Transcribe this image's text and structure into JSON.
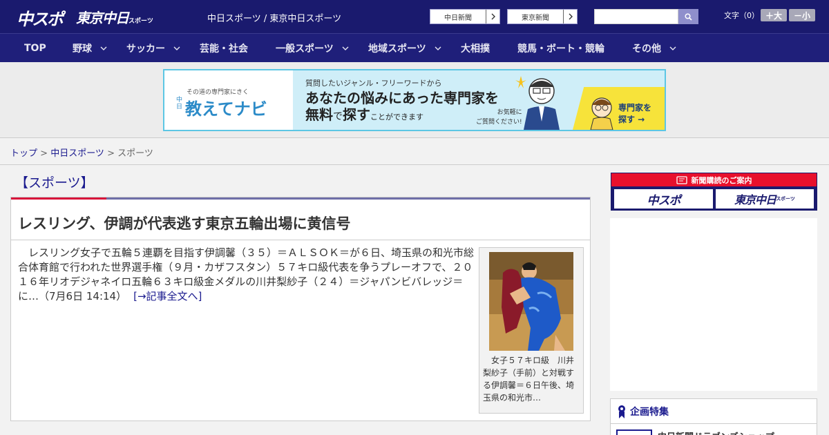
{
  "header": {
    "logo_chuspo": "中スポ",
    "logo_tokyo": "東京中日",
    "logo_tokyo_suffix": "スポーツ",
    "title": "中日スポーツ / 東京中日スポーツ",
    "paper_links": [
      "中日新聞",
      "東京新聞"
    ],
    "search": {
      "value": "",
      "placeholder": ""
    },
    "font_size_label": "文字（0）",
    "font_larger": "＋大",
    "font_smaller": "－小"
  },
  "nav": {
    "items": [
      {
        "label": "TOP",
        "has_menu": false
      },
      {
        "label": "野球",
        "has_menu": true
      },
      {
        "label": "サッカー",
        "has_menu": true
      },
      {
        "label": "芸能・社会",
        "has_menu": false
      },
      {
        "label": "一般スポーツ",
        "has_menu": true
      },
      {
        "label": "地域スポーツ",
        "has_menu": true
      },
      {
        "label": "大相撲",
        "has_menu": false
      },
      {
        "label": "競馬・ボート・競輪",
        "has_menu": false
      },
      {
        "label": "その他",
        "has_menu": true
      }
    ]
  },
  "ad_banner": {
    "tagline": "その道の専門家にきく",
    "brand_prefix": "中日",
    "brand": "教えてナビ",
    "line1": "質問したいジャンル・フリーワードから",
    "line2": "あなたの悩みにあった専門家を",
    "line3_a": "無料",
    "line3_b": "で",
    "line3_c": "探す",
    "line3_d": "ことができます",
    "note_1": "お気軽に",
    "note_2": "ご質問ください!",
    "cta_1": "専門家を",
    "cta_2": "探す →"
  },
  "breadcrumb": {
    "top": "トップ",
    "section": "中日スポーツ",
    "current": "スポーツ",
    "separator": " > "
  },
  "article": {
    "section": "【スポーツ】",
    "headline": "レスリング、伊調が代表逃す東京五輪出場に黄信号",
    "body": "レスリング女子で五輪５連覇を目指す伊調馨（３５）＝ＡＬＳＯＫ＝が６日、埼玉県の和光市総合体育館で行われた世界選手権（９月・カザフスタン）５７キロ級代表を争うプレーオフで、２０１６年リオデジャネイロ五輪６３キロ級金メダルの川井梨紗子（２４）＝ジャパンビバレッジ＝に…",
    "date": "（7月6日 14:14）",
    "more_link": "[→記事全文へ]",
    "photo_caption": "女子５７キロ級　川井梨紗子（手前）と対戦する伊調馨＝６日午後、埼玉県の和光市…"
  },
  "sidebar": {
    "subscribe_header": "新聞購読のご案内",
    "subscribe_chuspo": "中スポ",
    "subscribe_tokyo": "東京中日",
    "subscribe_tokyo_suffix": "スポーツ",
    "feature_header": "企画特集",
    "feature_item": "中日新聞ドラゴンズショップ"
  },
  "colors": {
    "header_bg": "#1a1a6e",
    "nav_bg": "#1f1f7a",
    "accent_red": "#d8143a",
    "link": "#1a1a8e"
  },
  "icons": [
    "chevron-right-icon",
    "search-icon",
    "chevron-down-icon",
    "ticket-icon",
    "ribbon-icon"
  ]
}
